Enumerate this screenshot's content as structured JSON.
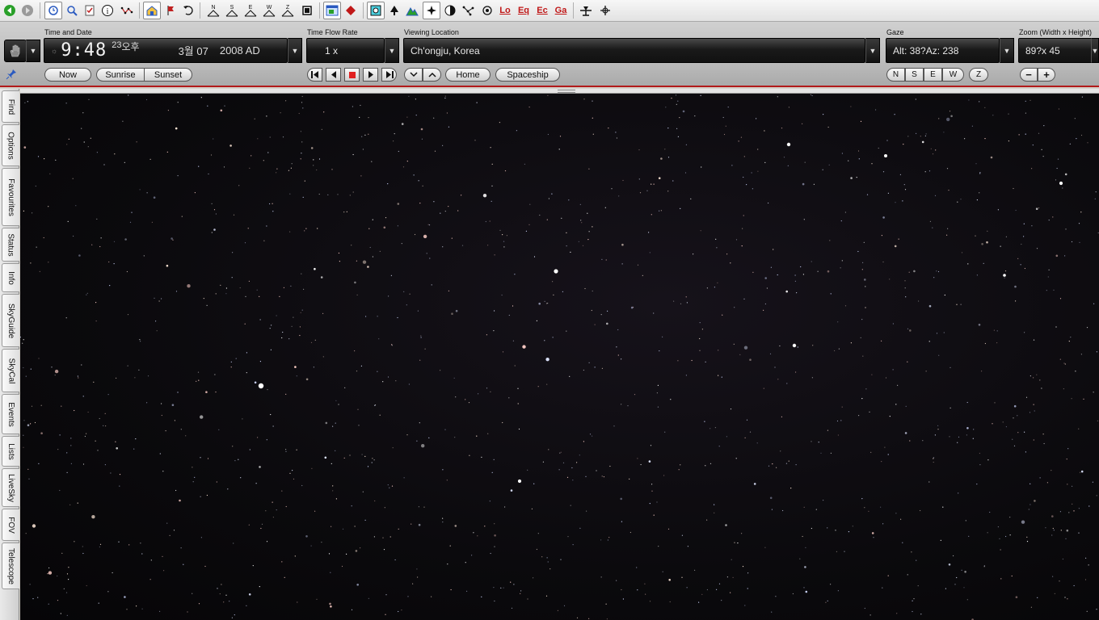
{
  "toolbar": {
    "icons": [
      "back-icon",
      "forward-icon",
      "time-refresh-icon",
      "find-magnifier-icon",
      "checklist-icon",
      "info-icon",
      "constellation-icon",
      "home-icon",
      "flag-icon",
      "undo-icon",
      "north-horizon-icon",
      "south-horizon-icon",
      "east-horizon-icon",
      "west-horizon-icon",
      "zenith-icon",
      "frame-icon",
      "window-icon",
      "red-diamond-icon",
      "view-square-icon",
      "tree-icon",
      "mountain-icon",
      "star-icon",
      "globe-icon",
      "asterism-icon",
      "galaxy-icon",
      "local-grid-icon",
      "equatorial-grid-icon",
      "ecliptic-grid-icon",
      "galactic-grid-icon",
      "telescope-icon",
      "crosshair-icon"
    ],
    "grid_labels": {
      "local": "Lo",
      "equatorial": "Eq",
      "ecliptic": "Ec",
      "galactic": "Ga"
    },
    "horizon_labels": {
      "n": "N",
      "s": "S",
      "e": "E",
      "w": "W",
      "z": "Z"
    }
  },
  "time_date": {
    "label": "Time and Date",
    "clock": "9:48",
    "seconds": "23",
    "ampm": "오후",
    "date": "3월 07",
    "year": "2008 AD"
  },
  "time_flow": {
    "label": "Time Flow Rate",
    "rate": "1 x"
  },
  "location": {
    "label": "Viewing Location",
    "value": "Ch'ongju, Korea"
  },
  "gaze": {
    "label": "Gaze",
    "value": "Alt: 38?Az: 238"
  },
  "zoom": {
    "label": "Zoom (Width x Height)",
    "value": "89?x 45"
  },
  "buttons": {
    "now": "Now",
    "sunrise": "Sunrise",
    "sunset": "Sunset",
    "home": "Home",
    "spaceship": "Spaceship",
    "n": "N",
    "s": "S",
    "e": "E",
    "w": "W",
    "z": "Z",
    "minus": "−",
    "plus": "+"
  },
  "side_tabs": [
    "Find",
    "Options",
    "Favourites",
    "Status",
    "Info",
    "SkyGuide",
    "SkyCal",
    "Events",
    "Lists",
    "LiveSky",
    "FOV",
    "Telescope"
  ],
  "colors": {
    "accent_red": "#b21a1a",
    "sky": "#0b0a0d",
    "field_dark": "#111111"
  }
}
